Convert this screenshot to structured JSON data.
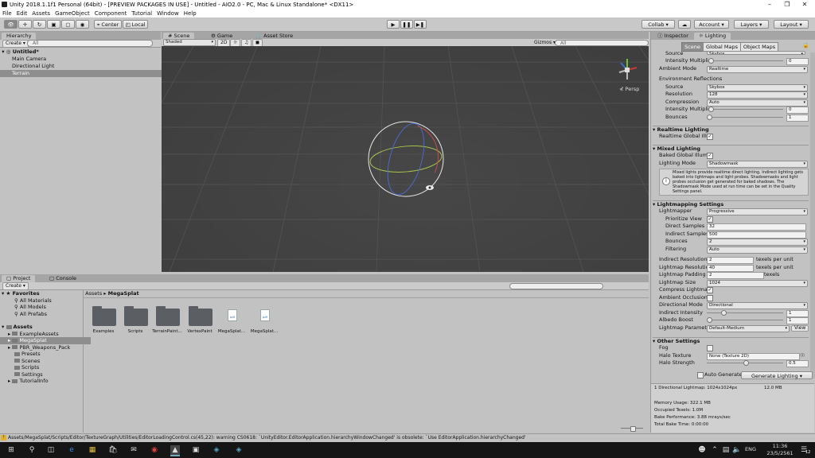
{
  "window": {
    "title": "Unity 2018.1.1f1 Personal (64bit) - [PREVIEW PACKAGES IN USE] - Untitled - AIO2.0 - PC, Mac & Linux Standalone* <DX11>"
  },
  "menu": [
    "File",
    "Edit",
    "Assets",
    "GameObject",
    "Component",
    "Tutorial",
    "Window",
    "Help"
  ],
  "toolbar": {
    "pivot": "Center",
    "space": "Local",
    "collab": "Collab",
    "account": "Account",
    "layers": "Layers",
    "layout": "Layout"
  },
  "hierarchy": {
    "tab": "Hierarchy",
    "create": "Create",
    "search": "All",
    "scene": "Untitled*",
    "items": [
      "Main Camera",
      "Directional Light",
      "Terrain"
    ]
  },
  "scene_view": {
    "tabs": [
      "Scene",
      "Game",
      "Asset Store"
    ],
    "shading": "Shaded",
    "mode2d": "2D",
    "gizmos": "Gizmos",
    "search": "All",
    "persp": "Persp"
  },
  "project": {
    "tabs": [
      "Project",
      "Console"
    ],
    "create": "Create",
    "breadcrumb": [
      "Assets",
      "MegaSplat"
    ],
    "favorites_label": "Favorites",
    "favorites": [
      "All Materials",
      "All Models",
      "All Prefabs"
    ],
    "assets_label": "Assets",
    "assets": [
      "ExampleAssets",
      "MegaSplat",
      "PBR_Weapons_Pack",
      "Presets",
      "Scenes",
      "Scripts",
      "Settings",
      "TutorialInfo"
    ],
    "files": [
      "Examples",
      "Scripts",
      "TerrainPaint...",
      "VertexPaint",
      "MegaSplat...",
      "MegaSplat..."
    ]
  },
  "inspector": {
    "tabs": [
      "Inspector",
      "Lighting"
    ],
    "subtabs": [
      "Scene",
      "Global Maps",
      "Object Maps"
    ],
    "env": {
      "source_cut": "Source",
      "source_val": "Skybox",
      "intensity": "Intensity Multiplie",
      "intensity_val": "0",
      "ambient_mode": "Ambient Mode",
      "ambient_val": "Realtime",
      "reflections": "Environment Reflections",
      "r_source": "Source",
      "r_source_val": "Skybox",
      "resolution": "Resolution",
      "resolution_val": "128",
      "compression": "Compression",
      "compression_val": "Auto",
      "r_intensity": "Intensity Multiplie",
      "r_intensity_val": "0",
      "bounces": "Bounces",
      "bounces_val": "1"
    },
    "realtime": {
      "title": "Realtime Lighting",
      "gi": "Realtime Global Illu"
    },
    "mixed": {
      "title": "Mixed Lighting",
      "baked": "Baked Global Illum",
      "mode": "Lighting Mode",
      "mode_val": "Shadowmask",
      "info": "Mixed lights provide realtime direct lighting. Indirect lighting gets baked into lightmaps and light probes. Shadowmasks and light probes occlusion get generated for baked shadows. The Shadowmask Mode used at run time can be set in the Quality Settings panel."
    },
    "lightmapping": {
      "title": "Lightmapping Settings",
      "lightmapper": "Lightmapper",
      "lightmapper_val": "Progressive",
      "prioritize": "Prioritize View",
      "direct": "Direct Samples",
      "direct_val": "32",
      "indirect": "Indirect Samples",
      "indirect_val": "500",
      "bounces": "Bounces",
      "bounces_val": "2",
      "filtering": "Filtering",
      "filtering_val": "Auto",
      "ind_res": "Indirect Resolution",
      "ind_res_val": "2",
      "ind_res_unit": "texels per unit",
      "lm_res": "Lightmap Resolution",
      "lm_res_val": "40",
      "lm_res_unit": "texels per unit",
      "padding": "Lightmap Padding",
      "padding_val": "2",
      "padding_unit": "texels",
      "size": "Lightmap Size",
      "size_val": "1024",
      "compress": "Compress Lightmap",
      "ao": "Ambient Occlusion",
      "dir_mode": "Directional Mode",
      "dir_mode_val": "Directional",
      "ind_int": "Indirect Intensity",
      "ind_int_val": "1",
      "albedo": "Albedo Boost",
      "albedo_val": "1",
      "params": "Lightmap Paramete",
      "params_val": "Default-Medium",
      "view": "View"
    },
    "other": {
      "title": "Other Settings",
      "fog": "Fog",
      "halo_tex": "Halo Texture",
      "halo_tex_val": "None (Texture 2D)",
      "halo_str": "Halo Strength",
      "halo_str_val": "0.5"
    },
    "auto": "Auto Generate",
    "generate": "Generate Lighting",
    "stats": {
      "lightmaps": "1 Directional Lightmap: 1024x1024px",
      "lightmaps_size": "12.0 MB",
      "memory": "Memory Usage: 322.1 MB",
      "texels": "Occupied Texels: 1.0M",
      "perf": "Bake Performance: 3.88 mrays/sec",
      "time": "Total Bake Time: 0:00:00"
    }
  },
  "status": "Assets/MegaSplat/Scripts/Editor/TextureGraph/Utilities/EditorLoadingControl.cs(45,22): warning CS0618: `UnityEditor.EditorApplication.hierarchyWindowChanged' is obsolete: `Use EditorApplication.hierarchyChanged'",
  "taskbar": {
    "time": "11:36",
    "date": "23/5/2561",
    "lang": "ENG",
    "notif": "12"
  }
}
